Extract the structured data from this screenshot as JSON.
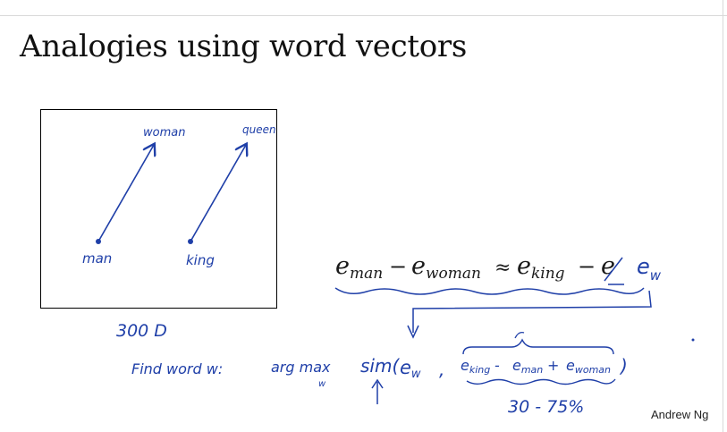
{
  "slide": {
    "title": "Analogies using word vectors",
    "credit": "Andrew Ng"
  },
  "diagram": {
    "labels": {
      "man": "man",
      "woman": "woman",
      "king": "king",
      "queen": "queen"
    },
    "dimension_note": "300 D"
  },
  "equation": {
    "e": "e",
    "man": "man",
    "woman": "woman",
    "king": "king",
    "minus": "−",
    "approx": "≈",
    "handwritten_ew": "e",
    "handwritten_w": "w"
  },
  "find_word": {
    "lead": "Find word w:",
    "argmax": "arg max",
    "argmax_sub": "w",
    "sim": "sim(",
    "ew": "e",
    "ew_sub": "w",
    "comma": ",",
    "eking": "e",
    "eking_sub": "king",
    "dash": " - ",
    "eman": "e",
    "eman_sub": "man",
    "plus": " + ",
    "ewoman": "e",
    "ewoman_sub": "woman",
    "close": ")",
    "accuracy": "30 - 75%"
  },
  "colors": {
    "ink": "#1f3fa8",
    "text": "#111111"
  }
}
